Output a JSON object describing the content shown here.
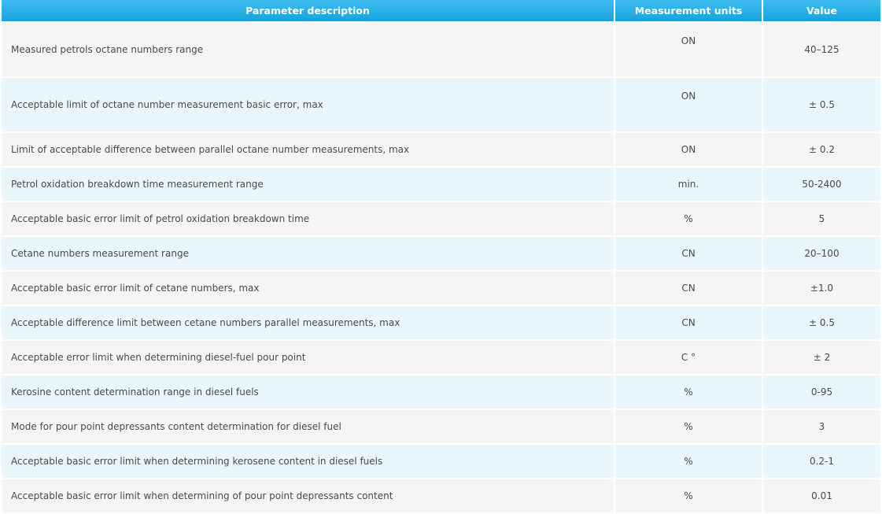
{
  "table": {
    "headers": {
      "description": "Parameter description",
      "units": "Measurement units",
      "value": "Value"
    },
    "rows": [
      {
        "description": "Measured petrols octane numbers range",
        "units": "ON",
        "value": "40–125"
      },
      {
        "description": "Acceptable limit of octane number measurement basic error, max",
        "units": "ON",
        "value": "± 0.5"
      },
      {
        "description": "Limit of acceptable difference between parallel octane number measurements, max",
        "units": "ON",
        "value": "± 0.2"
      },
      {
        "description": "Petrol oxidation breakdown time measurement range",
        "units": "min.",
        "value": "50-2400"
      },
      {
        "description": "Acceptable basic error limit of petrol oxidation breakdown time",
        "units": "%",
        "value": "5"
      },
      {
        "description": "Cetane numbers measurement range",
        "units": "CN",
        "value": "20–100"
      },
      {
        "description": "Acceptable basic error limit of cetane numbers, max",
        "units": "CN",
        "value": "±1.0"
      },
      {
        "description": "Acceptable difference limit between cetane numbers parallel measurements, max",
        "units": "CN",
        "value": "± 0.5"
      },
      {
        "description": "Acceptable error limit when determining diesel-fuel pour point",
        "units": "C °",
        "value": "± 2"
      },
      {
        "description": "Kerosine content determination range in diesel fuels",
        "units": "%",
        "value": "0-95"
      },
      {
        "description": "Mode for pour point depressants content determination for diesel fuel",
        "units": "%",
        "value": "3"
      },
      {
        "description": "Acceptable basic error limit when determining kerosene content in diesel fuels",
        "units": "%",
        "value": "0.2-1"
      },
      {
        "description": "Acceptable basic error limit when determining of pour point depressants content",
        "units": "%",
        "value": "0.01"
      }
    ]
  }
}
